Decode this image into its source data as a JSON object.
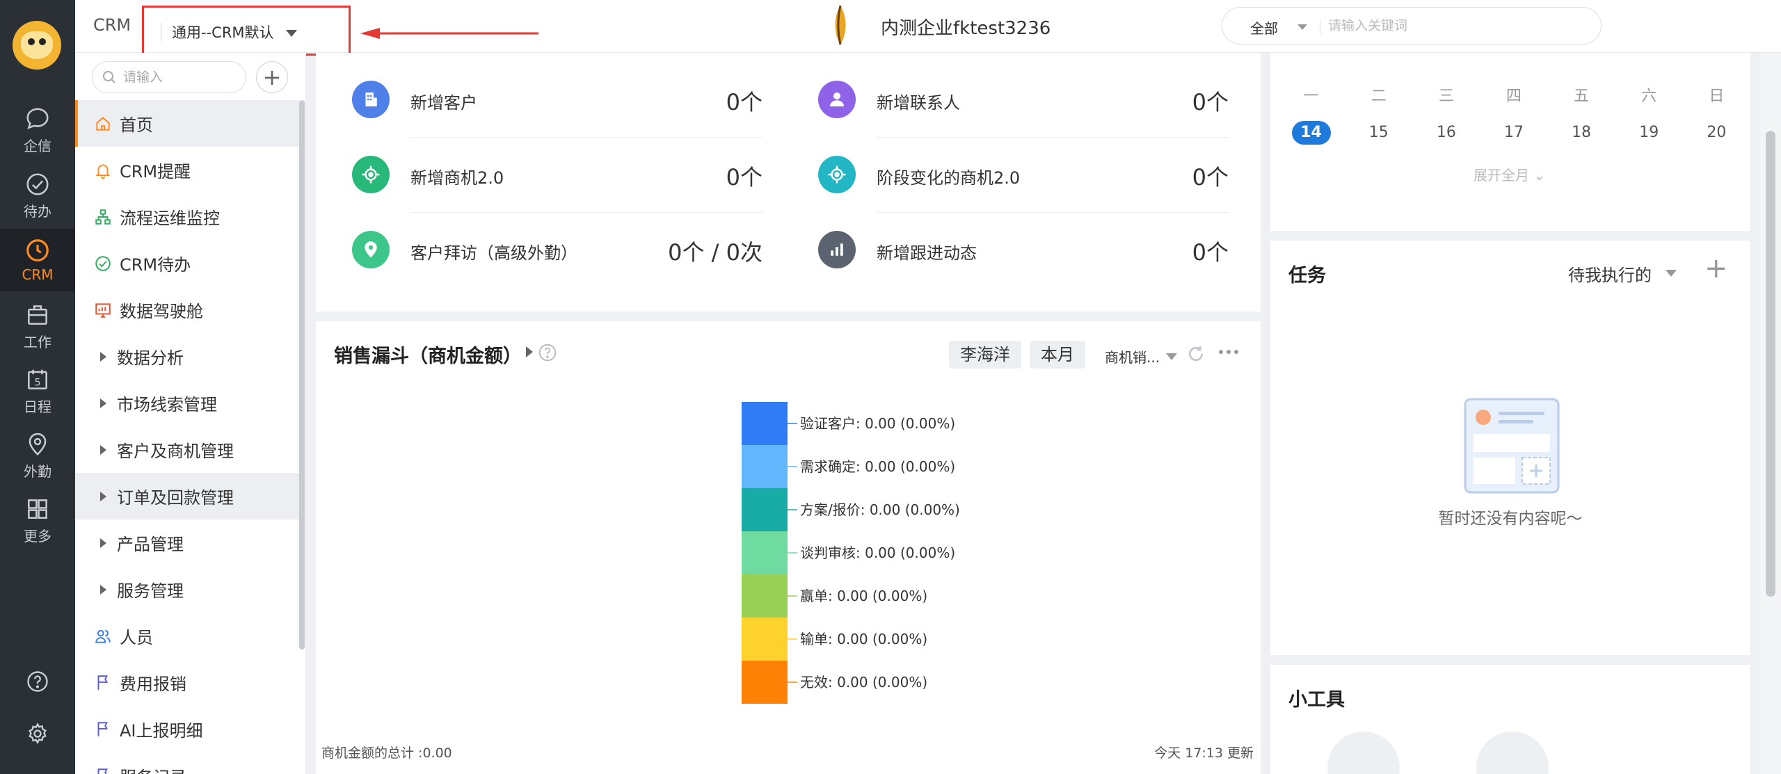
{
  "rail": {
    "items": [
      {
        "label": "企信",
        "icon": "chat-icon"
      },
      {
        "label": "待办",
        "icon": "check-circle-icon"
      },
      {
        "label": "CRM",
        "icon": "clock-icon"
      },
      {
        "label": "工作",
        "icon": "briefcase-icon"
      },
      {
        "label": "日程",
        "icon": "calendar-icon",
        "badge": "5"
      },
      {
        "label": "外勤",
        "icon": "location-icon"
      },
      {
        "label": "更多",
        "icon": "grid-icon"
      }
    ],
    "active_color": "#ff8a1e"
  },
  "topbar": {
    "crm_label": "CRM",
    "view_select": "通用--CRM默认",
    "company_name": "内测企业fktest3236",
    "search_scope": "全部",
    "search_placeholder": "请输入关键词"
  },
  "sidebar": {
    "search_placeholder": "请输入",
    "add_label": "+",
    "items": [
      {
        "label": "首页",
        "icon": "home-icon"
      },
      {
        "label": "CRM提醒",
        "icon": "bell-icon"
      },
      {
        "label": "流程运维监控",
        "icon": "flowchart-icon"
      },
      {
        "label": "CRM待办",
        "icon": "check-circle-icon"
      },
      {
        "label": "数据驾驶舱",
        "icon": "dashboard-icon"
      },
      {
        "label": "数据分析",
        "icon": "expand-arrow-icon"
      },
      {
        "label": "市场线索管理",
        "icon": "expand-arrow-icon"
      },
      {
        "label": "客户及商机管理",
        "icon": "expand-arrow-icon"
      },
      {
        "label": "订单及回款管理",
        "icon": "expand-arrow-icon"
      },
      {
        "label": "产品管理",
        "icon": "expand-arrow-icon"
      },
      {
        "label": "服务管理",
        "icon": "expand-arrow-icon"
      },
      {
        "label": "人员",
        "icon": "people-icon"
      },
      {
        "label": "费用报销",
        "icon": "flag-icon"
      },
      {
        "label": "AI上报明细",
        "icon": "flag-icon"
      },
      {
        "label": "服务记录",
        "icon": "flag-icon"
      }
    ]
  },
  "stats": [
    {
      "label": "新增客户",
      "value": "0个",
      "icon": "building-icon",
      "color": "#4f7fe8"
    },
    {
      "label": "新增联系人",
      "value": "0个",
      "icon": "person-icon",
      "color": "#8e63e8"
    },
    {
      "label": "新增商机2.0",
      "value": "0个",
      "icon": "target-icon",
      "color": "#27b87a"
    },
    {
      "label": "阶段变化的商机2.0",
      "value": "0个",
      "icon": "target-icon",
      "color": "#23b6c4"
    },
    {
      "label": "客户拜访（高级外勤）",
      "value": "0个 / 0次",
      "icon": "location-pin-icon",
      "color": "#3cc68a"
    },
    {
      "label": "新增跟进动态",
      "value": "0个",
      "icon": "bar-chart-icon",
      "color": "#5b6270"
    }
  ],
  "funnel": {
    "title": "销售漏斗（商机金额）",
    "owner_chip": "李海洋",
    "period_chip": "本月",
    "metric_select": "商机销...",
    "total_label": "商机金额的总计 :0.00",
    "updated_label": "今天 17:13 更新"
  },
  "chart_data": {
    "type": "bar",
    "title": "销售漏斗（商机金额）",
    "categories": [
      "验证客户",
      "需求确定",
      "方案/报价",
      "谈判审核",
      "赢单",
      "输单",
      "无效"
    ],
    "values": [
      0.0,
      0.0,
      0.0,
      0.0,
      0.0,
      0.0,
      0.0
    ],
    "labels": [
      "验证客户: 0.00 (0.00%)",
      "需求确定: 0.00 (0.00%)",
      "方案/报价: 0.00 (0.00%)",
      "谈判审核: 0.00 (0.00%)",
      "赢单: 0.00 (0.00%)",
      "输单: 0.00 (0.00%)",
      "无效: 0.00 (0.00%)"
    ],
    "colors": [
      "#2f7cf6",
      "#62b6fb",
      "#19aca6",
      "#6fdba0",
      "#98cf55",
      "#fdd22c",
      "#fd8205"
    ]
  },
  "calendar": {
    "weekdays": [
      "一",
      "二",
      "三",
      "四",
      "五",
      "六",
      "日"
    ],
    "days": [
      "14",
      "15",
      "16",
      "17",
      "18",
      "19",
      "20"
    ],
    "today": "14",
    "expand_label": "展开全月",
    "accent": "#1f7bdb"
  },
  "tasks": {
    "title": "任务",
    "filter": "待我执行的",
    "empty_text": "暂时还没有内容呢～"
  },
  "tools": {
    "title": "小工具"
  }
}
